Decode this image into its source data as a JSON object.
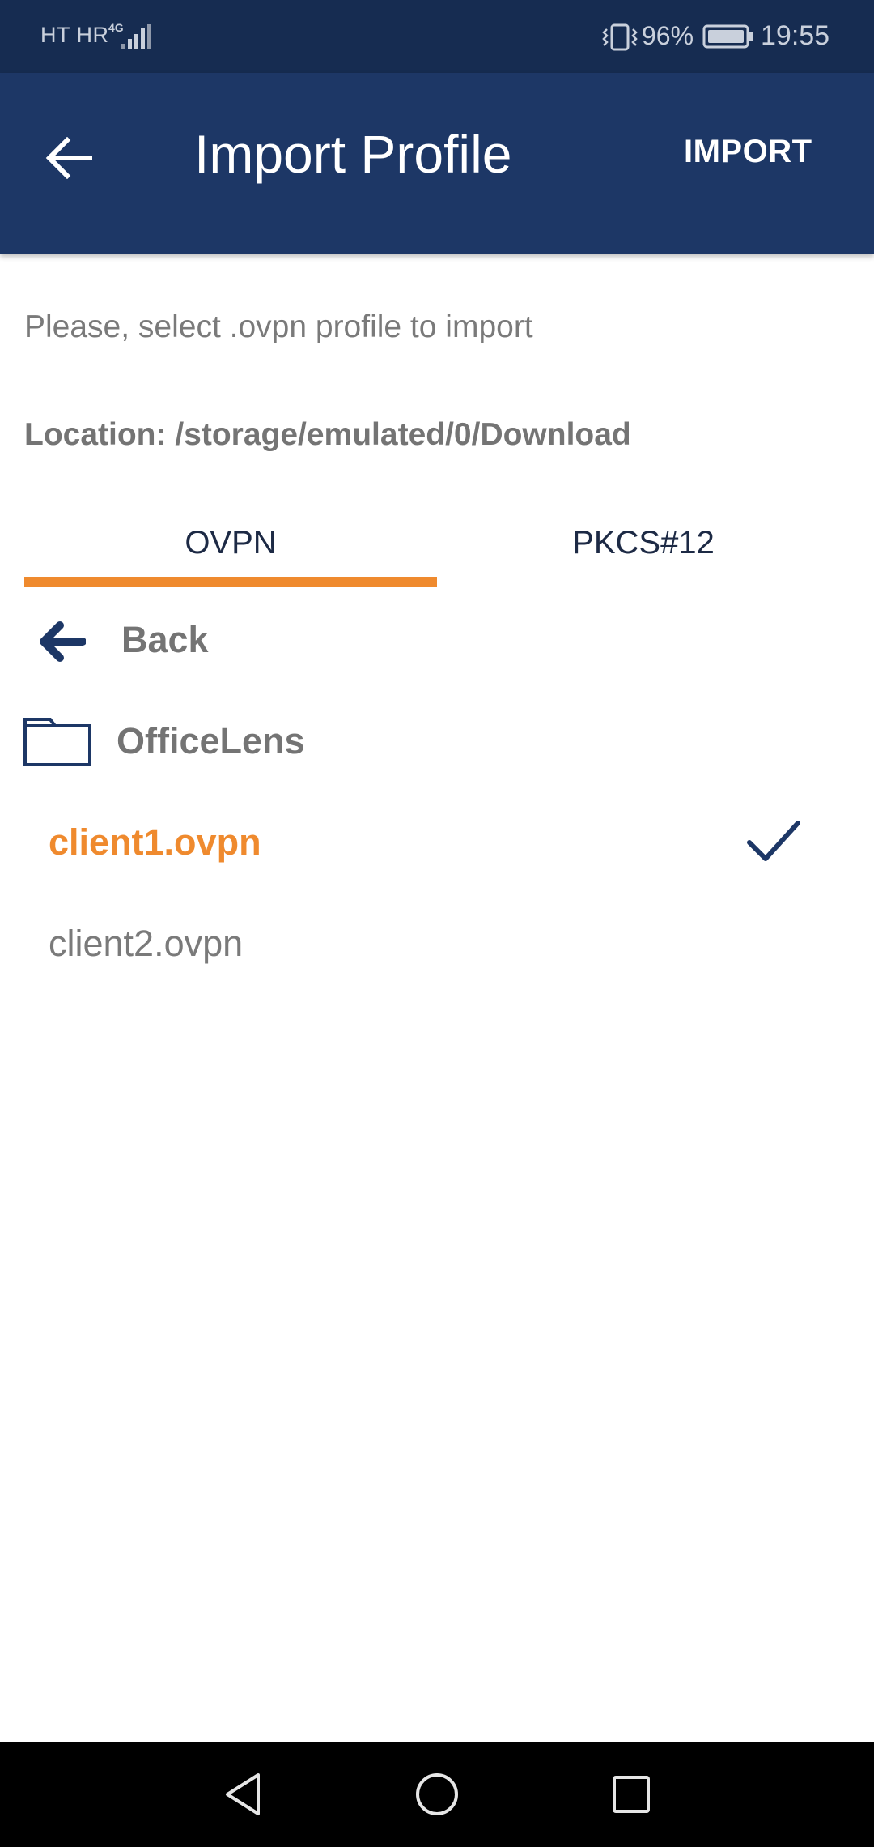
{
  "status_bar": {
    "carrier": "HT HR",
    "network_type": "4G",
    "battery_percent": "96%",
    "time": "19:55",
    "icons": [
      "signal-icon",
      "vibrate-icon",
      "battery-icon"
    ]
  },
  "app_bar": {
    "title": "Import Profile",
    "action_label": "IMPORT",
    "back_icon": "arrow-left-icon"
  },
  "content": {
    "instruction": "Please, select .ovpn profile to import",
    "location": "Location: /storage/emulated/0/Download"
  },
  "tabs": [
    {
      "label": "OVPN",
      "selected": true
    },
    {
      "label": "PKCS#12",
      "selected": false
    }
  ],
  "file_list": {
    "back_label": "Back",
    "items": [
      {
        "type": "folder",
        "name": "OfficeLens",
        "icon": "folder-icon"
      },
      {
        "type": "file",
        "name": "client1.ovpn",
        "selected": true
      },
      {
        "type": "file",
        "name": "client2.ovpn",
        "selected": false
      }
    ]
  },
  "nav_bar": {
    "icons": [
      "nav-back-icon",
      "nav-home-icon",
      "nav-recents-icon"
    ]
  },
  "colors": {
    "status_bar": "#162c51",
    "app_bar": "#1d3766",
    "accent": "#ef8a2e",
    "text_gray": "#747474",
    "icon_navy": "#1d3766"
  }
}
